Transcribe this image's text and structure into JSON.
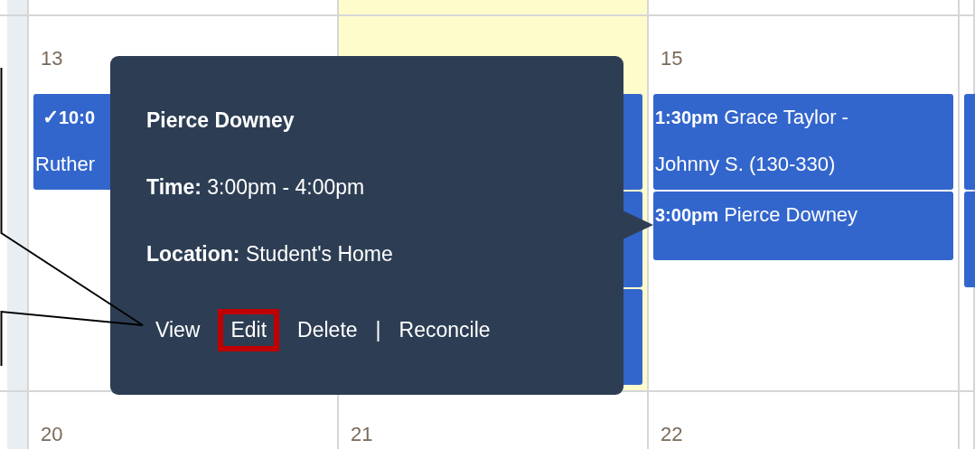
{
  "calendar": {
    "weeks": [
      {
        "days": [
          {
            "date": "13",
            "today": false,
            "events": [
              {
                "kind": "clipped",
                "check": "✓",
                "time": "10:0",
                "title": "Ruther"
              }
            ]
          },
          {
            "today": true,
            "events": [
              {
                "kind": "covered"
              },
              {
                "kind": "covered"
              },
              {
                "kind": "covered"
              }
            ]
          },
          {
            "date": "15",
            "today": false,
            "events": [
              {
                "kind": "visible",
                "time": "1:30pm",
                "title": "Grace Taylor - Johnny S. (130-330)"
              },
              {
                "kind": "visible",
                "time": "3:00pm",
                "title": "Pierce Downey"
              }
            ]
          },
          {
            "today": false,
            "events": [
              {
                "kind": "covered"
              },
              {
                "kind": "covered"
              }
            ]
          }
        ]
      },
      {
        "days": [
          {
            "date": "20",
            "today": false
          },
          {
            "date": "21",
            "today": false
          },
          {
            "date": "22",
            "today": false
          },
          {
            "today": false
          }
        ]
      }
    ]
  },
  "popover": {
    "title": "Pierce Downey",
    "fields": [
      {
        "label": "Time:",
        "value": "3:00pm - 4:00pm"
      },
      {
        "label": "Location:",
        "value": "Student's Home"
      }
    ],
    "actions": [
      {
        "label": "View",
        "highlighted": false
      },
      {
        "label": "Edit",
        "highlighted": true
      },
      {
        "label": "Delete",
        "highlighted": false
      },
      {
        "label": "Reconcile",
        "highlighted": false,
        "separator": "|"
      }
    ]
  }
}
